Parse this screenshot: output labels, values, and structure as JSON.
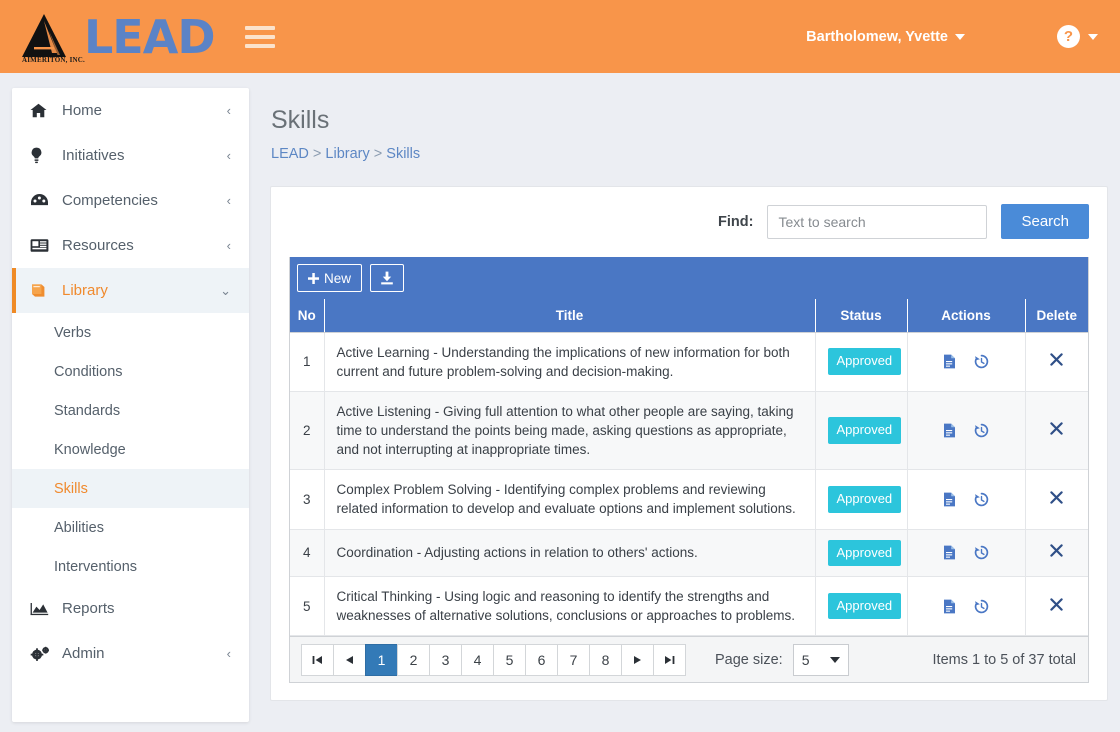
{
  "colors": {
    "header_orange": "#f8954a",
    "brand_blue": "#5b83c6",
    "grid_blue": "#4a77c4",
    "search_blue": "#4a8bd8",
    "badge_teal": "#2cc5dc",
    "active_orange": "#f08a2e",
    "page_bg": "#eceef3"
  },
  "header": {
    "brand_name": "LEAD",
    "brand_sub": "AIMERITON, INC.",
    "menu_icon": "hamburger-icon",
    "user_name": "Bartholomew, Yvette",
    "user_caret": "caret-down-icon",
    "help_icon": "question-mark-icon",
    "help_caret": "caret-down-icon"
  },
  "sidebar": {
    "items": [
      {
        "label": "Home",
        "icon": "home-icon",
        "chevron": "‹",
        "name": "home"
      },
      {
        "label": "Initiatives",
        "icon": "lightbulb-icon",
        "chevron": "‹",
        "name": "initiatives"
      },
      {
        "label": "Competencies",
        "icon": "dashboard-icon",
        "chevron": "‹",
        "name": "competencies"
      },
      {
        "label": "Resources",
        "icon": "newspaper-icon",
        "chevron": "‹",
        "name": "resources"
      },
      {
        "label": "Library",
        "icon": "book-icon",
        "chevron": "⌄",
        "name": "library",
        "active": true
      }
    ],
    "library_subitems": [
      {
        "label": "Verbs",
        "name": "verbs"
      },
      {
        "label": "Conditions",
        "name": "conditions"
      },
      {
        "label": "Standards",
        "name": "standards"
      },
      {
        "label": "Knowledge",
        "name": "knowledge"
      },
      {
        "label": "Skills",
        "name": "skills",
        "active": true
      },
      {
        "label": "Abilities",
        "name": "abilities"
      },
      {
        "label": "Interventions",
        "name": "interventions"
      }
    ],
    "bottom_items": [
      {
        "label": "Reports",
        "icon": "chart-icon",
        "chevron": "",
        "name": "reports"
      },
      {
        "label": "Admin",
        "icon": "gears-icon",
        "chevron": "‹",
        "name": "admin"
      }
    ]
  },
  "page": {
    "title": "Skills",
    "breadcrumb": {
      "root": "LEAD",
      "sep1": ">",
      "mid": "Library",
      "sep2": ">",
      "current": "Skills"
    }
  },
  "search": {
    "label": "Find:",
    "placeholder": "Text to search",
    "value": "",
    "button": "Search"
  },
  "grid": {
    "toolbar": {
      "new_label": "New",
      "new_icon": "plus-icon",
      "export_icon": "download-icon"
    },
    "columns": {
      "no": "No",
      "title": "Title",
      "status": "Status",
      "actions": "Actions",
      "delete": "Delete"
    },
    "rows": [
      {
        "no": "1",
        "title": "Active Learning - Understanding the implications of new information for both current and future problem-solving and decision-making.",
        "status": "Approved"
      },
      {
        "no": "2",
        "title": "Active Listening - Giving full attention to what other people are saying, taking time to understand the points being made, asking questions as appropriate, and not interrupting at inappropriate times.",
        "status": "Approved"
      },
      {
        "no": "3",
        "title": "Complex Problem Solving - Identifying complex problems and reviewing related information to develop and evaluate options and implement solutions.",
        "status": "Approved"
      },
      {
        "no": "4",
        "title": "Coordination - Adjusting actions in relation to others' actions.",
        "status": "Approved"
      },
      {
        "no": "5",
        "title": "Critical Thinking - Using logic and reasoning to identify the strengths and weaknesses of alternative solutions, conclusions or approaches to problems.",
        "status": "Approved"
      }
    ],
    "row_action_icons": {
      "view": "document-icon",
      "history": "history-icon",
      "delete": "close-x-icon"
    }
  },
  "pager": {
    "first": "⏮",
    "prev": "◄",
    "next": "►",
    "last": "⏭",
    "pages": [
      "1",
      "2",
      "3",
      "4",
      "5",
      "6",
      "7",
      "8"
    ],
    "current_page": "1",
    "page_size_label": "Page size:",
    "page_size_value": "5",
    "items_total": "Items 1 to 5 of 37 total"
  }
}
